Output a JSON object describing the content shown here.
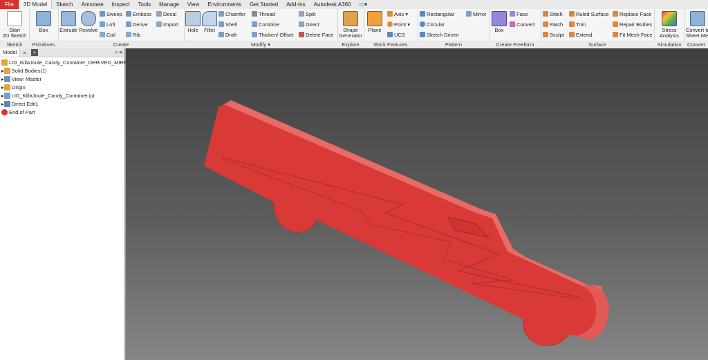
{
  "menu": {
    "tabs": [
      "File",
      "3D Model",
      "Sketch",
      "Annotate",
      "Inspect",
      "Tools",
      "Manage",
      "View",
      "Environments",
      "Get Started",
      "Add-Ins",
      "Autodesk A360"
    ],
    "active_tab": "3D Model"
  },
  "ribbon": {
    "sketch": {
      "label": "Sketch",
      "start_top": "Start",
      "start_bottom": "2D Sketch"
    },
    "primitives": {
      "label": "Primitives",
      "box": "Box"
    },
    "create": {
      "label": "Create",
      "extrude": "Extrude",
      "revolve": "Revolve",
      "sweep": "Sweep",
      "loft": "Loft",
      "coil": "Coil",
      "emboss": "Emboss",
      "derive": "Derive",
      "rib": "Rib",
      "decal": "Decal",
      "import": "Import"
    },
    "modify": {
      "label": "Modify",
      "hole": "Hole",
      "fillet": "Fillet",
      "chamfer": "Chamfer",
      "shell": "Shell",
      "draft": "Draft",
      "thread": "Thread",
      "combine": "Combine",
      "thicken": "Thicken/ Offset",
      "split": "Split",
      "direct": "Direct",
      "delete_face": "Delete Face"
    },
    "explore": {
      "label": "Explore",
      "shape_top": "Shape",
      "shape_bottom": "Generator"
    },
    "work_features": {
      "label": "Work Features",
      "plane": "Plane",
      "axis": "Axis",
      "point": "Point",
      "ucs": "UCS"
    },
    "pattern": {
      "label": "Pattern",
      "rectangular": "Rectangular",
      "circular": "Circular",
      "sketch_driven": "Sketch Driven",
      "mirror": "Mirror"
    },
    "freeform": {
      "label": "Create Freeform",
      "box": "Box",
      "face": "Face",
      "convert": "Convert"
    },
    "surface": {
      "label": "Surface",
      "stitch": "Stitch",
      "patch": "Patch",
      "sculpt": "Sculpt",
      "ruled_surface": "Ruled Surface",
      "trim": "Trim",
      "extend": "Extend",
      "replace_face": "Replace Face",
      "repair_bodies": "Repair Bodies",
      "fit_mesh_face": "Fit Mesh Face"
    },
    "simulation": {
      "label": "Simulation",
      "stress_top": "Stress",
      "stress_bottom": "Analysis"
    },
    "convert": {
      "label": "Convert",
      "top": "Convert to",
      "bottom": "Sheet Metal"
    }
  },
  "browser": {
    "tab": "Model",
    "close": "×",
    "plus": "+",
    "tools": "⌕ ≡",
    "items": [
      "LID_KillaJoule_Candy_Container_DERIVED_MIRROR.ipt",
      "Solid Bodies(1)",
      "View: Master",
      "Origin",
      "LID_KillaJoule_Candy_Container.ipt",
      "Direct Edit1",
      "End of Part"
    ]
  },
  "colors": {
    "model_red": "#d93a37",
    "file_tab": "#d8322a"
  }
}
